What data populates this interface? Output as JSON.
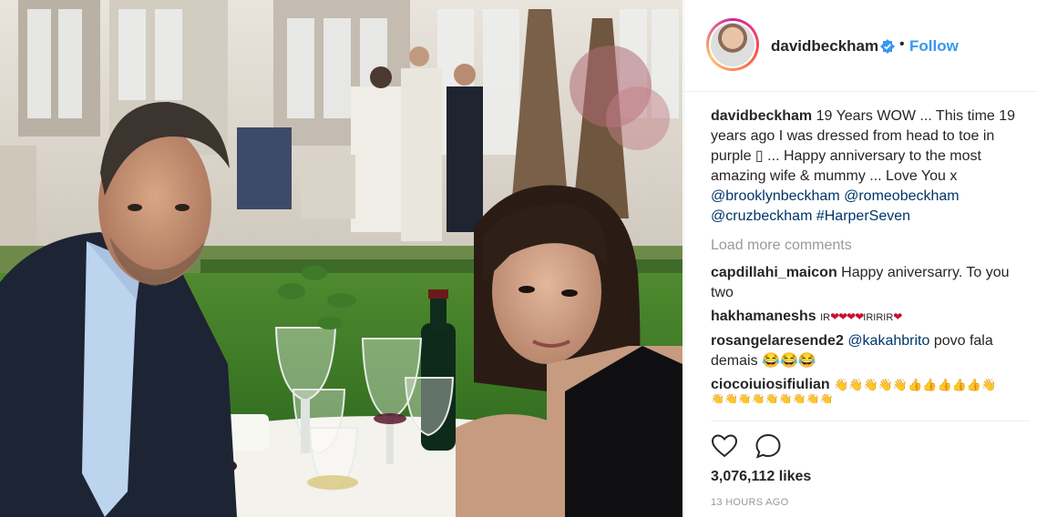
{
  "post": {
    "username": "davidbeckham",
    "follow_label": "Follow",
    "dot": "•",
    "caption": {
      "username": "davidbeckham",
      "line1": "19 Years WOW ... This time 19 years ago I was dressed from head to toe in purple ",
      "box_glyph": "▯",
      "line2": " ... Happy anniversary to the most amazing wife & mummy ... Love You x",
      "mentions": [
        "@brooklynbeckham",
        "@romeobeckham",
        "@cruzbeckham",
        "#HarperSeven"
      ]
    },
    "load_more": "Load more comments",
    "comments": [
      {
        "user": "capdillahi_maicon",
        "text": "Happy aniversarry. To you two"
      },
      {
        "user": "hakhamaneshs",
        "pre": "IR",
        "hearts": "❤❤❤❤",
        "mid": "IRIRIR",
        "hearts2": "❤"
      },
      {
        "user": "rosangelaresende2",
        "mention": "@kakahbrito",
        "text": " povo fala demais ",
        "emoji": "😂😂😂"
      },
      {
        "user": "ciocoiuiosifiulian",
        "hands": "👋👋👋👋👋👍👍👍👍👍👋",
        "hands2": "👋👋👋👋👋👋👋👋👋"
      }
    ],
    "likes": "3,076,112 likes",
    "time": "13 HOURS AGO"
  },
  "icons": {
    "heart": "heart-icon",
    "comment": "comment-icon",
    "verified": "verified-icon"
  },
  "colors": {
    "link": "#003569",
    "follow": "#3897f0",
    "muted": "#999999"
  }
}
